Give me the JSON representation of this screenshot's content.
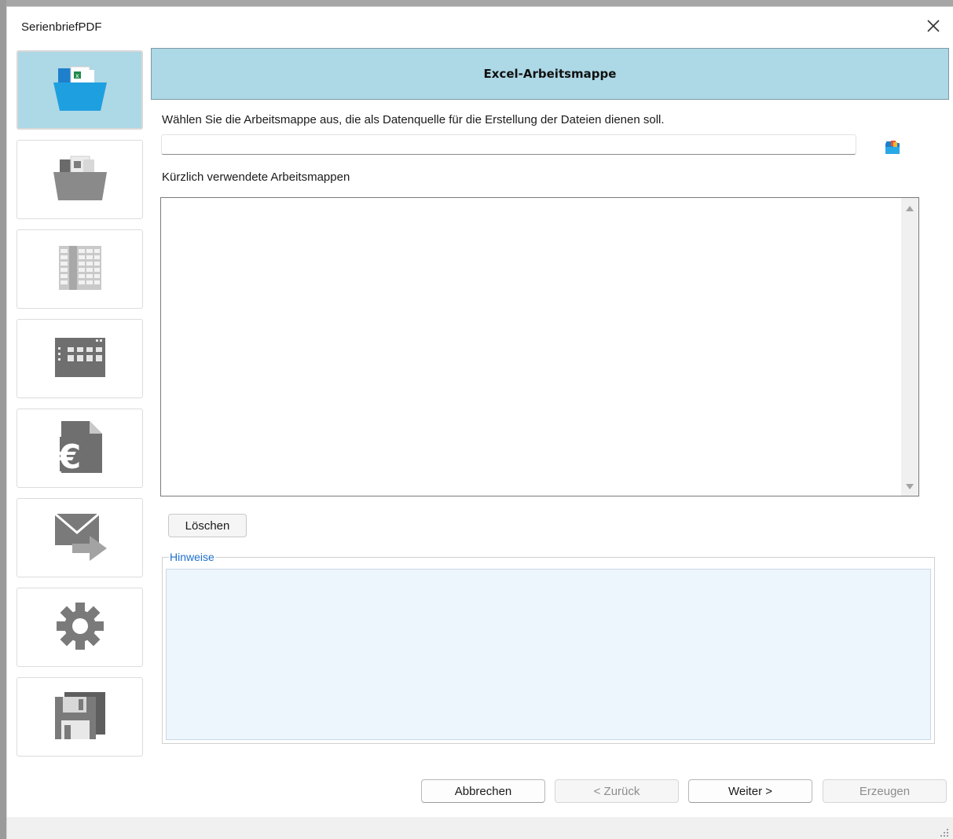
{
  "window": {
    "title": "SerienbriefPDF",
    "close_icon": "close-icon"
  },
  "nav": {
    "items": [
      {
        "name": "excel-workbook",
        "icon": "excel-folder-icon",
        "active": true
      },
      {
        "name": "excel-folder",
        "icon": "excel-folder-gray-icon",
        "active": false
      },
      {
        "name": "table",
        "icon": "table-grid-icon",
        "active": false
      },
      {
        "name": "layout",
        "icon": "layout-grid-icon",
        "active": false
      },
      {
        "name": "invoice",
        "icon": "euro-document-icon",
        "active": false
      },
      {
        "name": "mail",
        "icon": "mail-forward-icon",
        "active": false
      },
      {
        "name": "settings",
        "icon": "gear-icon",
        "active": false
      },
      {
        "name": "save",
        "icon": "floppy-disk-icon",
        "active": false
      }
    ]
  },
  "header": {
    "title": "Excel-Arbeitsmappe"
  },
  "main": {
    "description": "Wählen Sie die Arbeitsmappe aus, die als Datenquelle für die Erstellung der Dateien dienen soll.",
    "path_value": "",
    "browse_icon": "folder-open-icon",
    "recent_label": "Kürzlich verwendete Arbeitsmappen",
    "recent_items": [],
    "delete_label": "Löschen"
  },
  "hints": {
    "legend": "Hinweise",
    "text": ""
  },
  "footer": {
    "cancel_label": "Abbrechen",
    "back_label": "< Zurück",
    "next_label": "Weiter >",
    "create_label": "Erzeugen"
  },
  "colors": {
    "accent": "#add8e6",
    "hints_bg": "#eef6fd",
    "legend": "#1e6fcf",
    "icon_gray": "#7a7a7a"
  }
}
